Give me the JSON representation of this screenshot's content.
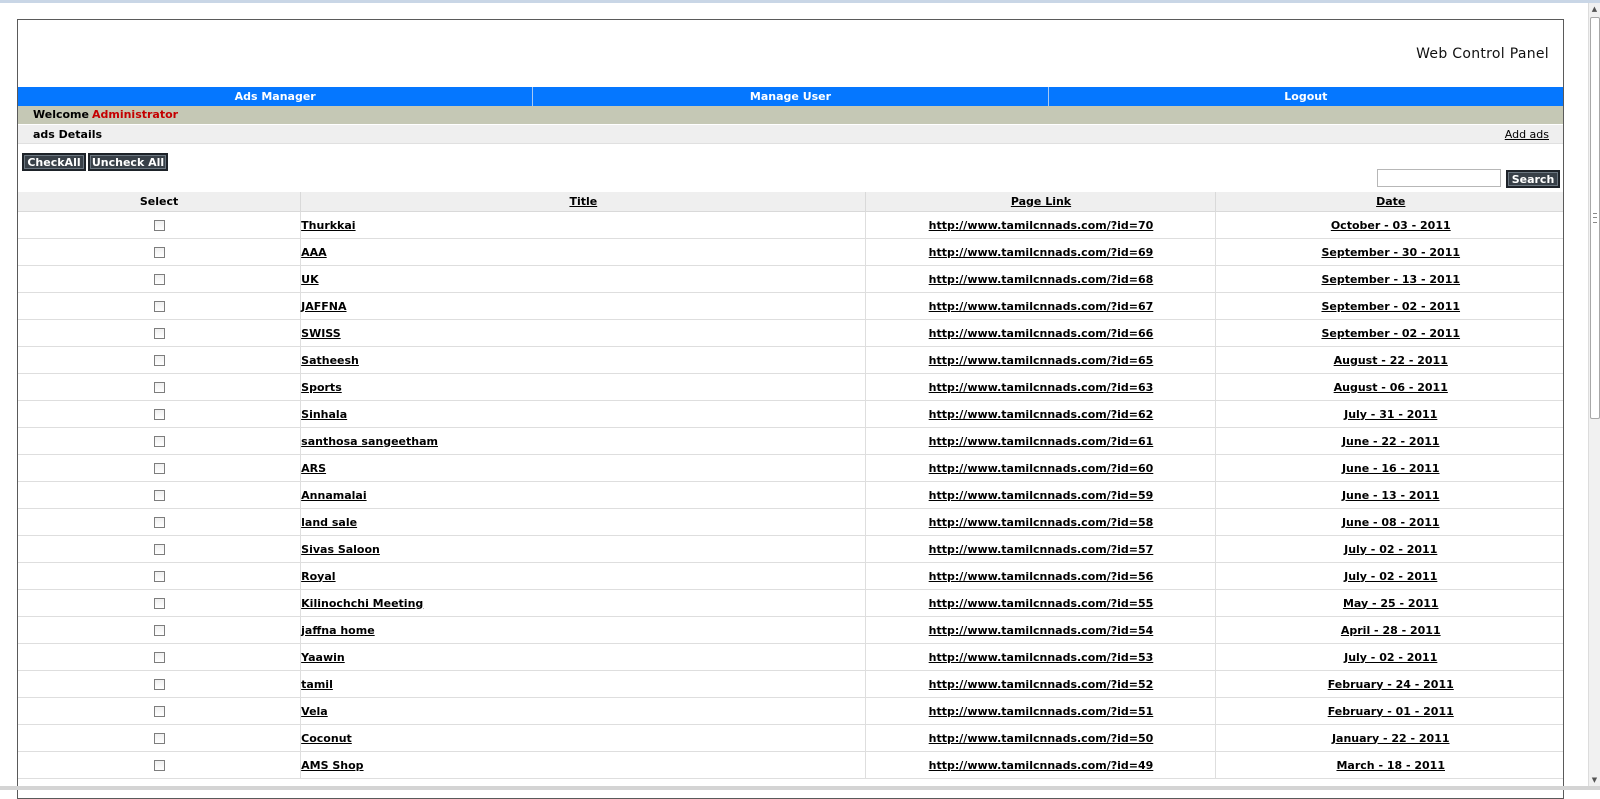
{
  "header": {
    "brand": "Web Control Panel"
  },
  "nav": [
    "Ads Manager",
    "Manage User",
    "Logout"
  ],
  "welcome": {
    "label": "Welcome",
    "user": "Administrator"
  },
  "details": {
    "title": "ads Details",
    "add_link": "Add ads"
  },
  "buttons": {
    "check_all": "CheckAll",
    "uncheck_all": "Uncheck All",
    "search": "Search"
  },
  "search": {
    "value": "",
    "placeholder": ""
  },
  "table": {
    "columns": [
      "Select",
      "Title",
      "Page Link",
      "Date"
    ],
    "rows": [
      {
        "title": "Thurkkai",
        "link": "http://www.tamilcnnads.com/?id=70",
        "date": "October - 03 - 2011"
      },
      {
        "title": "AAA",
        "link": "http://www.tamilcnnads.com/?id=69",
        "date": "September - 30 - 2011"
      },
      {
        "title": "UK",
        "link": "http://www.tamilcnnads.com/?id=68",
        "date": "September - 13 - 2011"
      },
      {
        "title": "JAFFNA",
        "link": "http://www.tamilcnnads.com/?id=67",
        "date": "September - 02 - 2011"
      },
      {
        "title": "SWISS",
        "link": "http://www.tamilcnnads.com/?id=66",
        "date": "September - 02 - 2011"
      },
      {
        "title": "Satheesh",
        "link": "http://www.tamilcnnads.com/?id=65",
        "date": "August - 22 - 2011"
      },
      {
        "title": "Sports",
        "link": "http://www.tamilcnnads.com/?id=63",
        "date": "August - 06 - 2011"
      },
      {
        "title": "Sinhala",
        "link": "http://www.tamilcnnads.com/?id=62",
        "date": "July - 31 - 2011"
      },
      {
        "title": "santhosa sangeetham",
        "link": "http://www.tamilcnnads.com/?id=61",
        "date": "June - 22 - 2011"
      },
      {
        "title": "ARS",
        "link": "http://www.tamilcnnads.com/?id=60",
        "date": "June - 16 - 2011"
      },
      {
        "title": "Annamalai",
        "link": "http://www.tamilcnnads.com/?id=59",
        "date": "June - 13 - 2011"
      },
      {
        "title": "land sale",
        "link": "http://www.tamilcnnads.com/?id=58",
        "date": "June - 08 - 2011"
      },
      {
        "title": "Sivas Saloon",
        "link": "http://www.tamilcnnads.com/?id=57",
        "date": "July - 02 - 2011"
      },
      {
        "title": "Royal",
        "link": "http://www.tamilcnnads.com/?id=56",
        "date": "July - 02 - 2011"
      },
      {
        "title": "Kilinochchi Meeting",
        "link": "http://www.tamilcnnads.com/?id=55",
        "date": "May - 25 - 2011"
      },
      {
        "title": "jaffna home",
        "link": "http://www.tamilcnnads.com/?id=54",
        "date": "April - 28 - 2011"
      },
      {
        "title": "Yaawin",
        "link": "http://www.tamilcnnads.com/?id=53",
        "date": "July - 02 - 2011"
      },
      {
        "title": "tamil",
        "link": "http://www.tamilcnnads.com/?id=52",
        "date": "February - 24 - 2011"
      },
      {
        "title": "Vela",
        "link": "http://www.tamilcnnads.com/?id=51",
        "date": "February - 01 - 2011"
      },
      {
        "title": "Coconut",
        "link": "http://www.tamilcnnads.com/?id=50",
        "date": "January - 22 - 2011"
      },
      {
        "title": "AMS Shop",
        "link": "http://www.tamilcnnads.com/?id=49",
        "date": "March - 18 - 2011"
      }
    ]
  }
}
